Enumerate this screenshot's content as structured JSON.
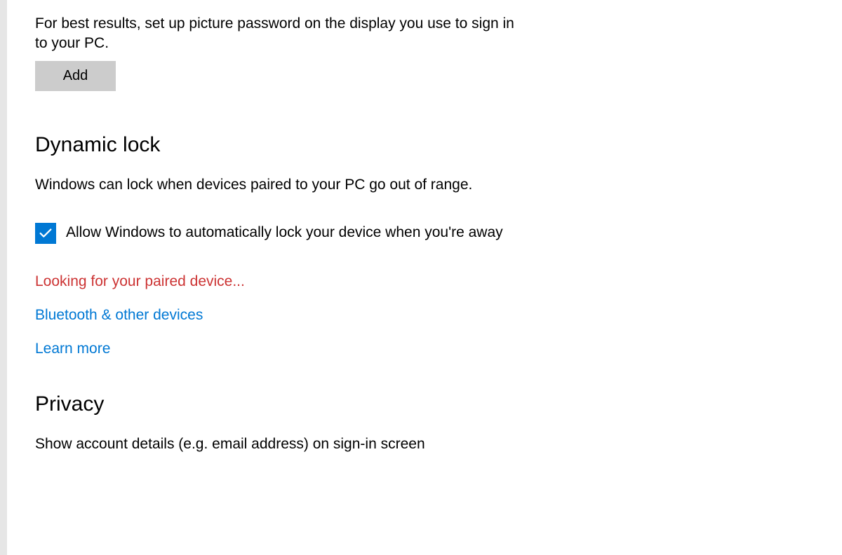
{
  "picturePassword": {
    "description": "For best results, set up picture password on the display you use to sign in to your PC.",
    "addButton": "Add"
  },
  "dynamicLock": {
    "heading": "Dynamic lock",
    "description": "Windows can lock when devices paired to your PC go out of range.",
    "checkboxLabel": "Allow Windows to automatically lock your device when you're away",
    "statusMessage": "Looking for your paired device...",
    "bluetoothLink": "Bluetooth & other devices",
    "learnMoreLink": "Learn more"
  },
  "privacy": {
    "heading": "Privacy",
    "description": "Show account details (e.g. email address) on sign-in screen"
  }
}
